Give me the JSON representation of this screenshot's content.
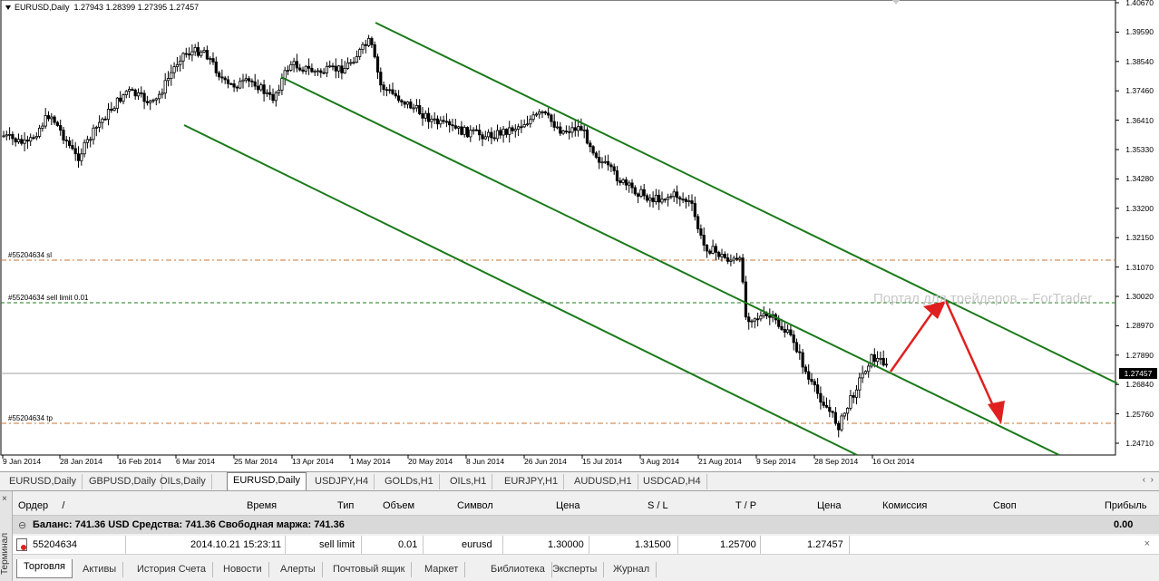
{
  "chart": {
    "title": "EURUSD,Daily",
    "ohlc": "1.27943 1.28399 1.27395 1.27457",
    "current_price": "1.27457",
    "watermark": "Портал для трейдеров – ForTrader",
    "price_labels": [
      "1.40670",
      "1.39590",
      "1.38540",
      "1.37460",
      "1.36410",
      "1.35330",
      "1.34280",
      "1.33200",
      "1.32150",
      "1.31070",
      "1.30020",
      "1.28970",
      "1.27890",
      "1.26840",
      "1.25760",
      "1.24710"
    ],
    "date_labels": [
      "9 Jan 2014",
      "28 Jan 2014",
      "16 Feb 2014",
      "6 Mar 2014",
      "25 Mar 2014",
      "13 Apr 2014",
      "1 May 2014",
      "20 May 2014",
      "8 Jun 2014",
      "26 Jun 2014",
      "15 Jul 2014",
      "3 Aug 2014",
      "21 Aug 2014",
      "9 Sep 2014",
      "28 Sep 2014",
      "16 Oct 2014"
    ],
    "levels": {
      "sl": "#55204634 sl",
      "sell_limit": "#55204634 sell limit 0.01",
      "tp": "#55204634 tp"
    }
  },
  "chart_tabs": [
    {
      "label": "EURUSD,Daily"
    },
    {
      "label": "GBPUSD,Daily"
    },
    {
      "label": "OILs,Daily"
    },
    {
      "label": "EURUSD,Daily",
      "active": true
    },
    {
      "label": "USDJPY,H4"
    },
    {
      "label": "GOLDs,H1"
    },
    {
      "label": "OILs,H1"
    },
    {
      "label": "EURJPY,H1"
    },
    {
      "label": "AUDUSD,H1"
    },
    {
      "label": "USDCAD,H4"
    }
  ],
  "terminal": {
    "side_label": "Терминал",
    "headers": {
      "order": "Ордер",
      "time": "Время",
      "type": "Тип",
      "volume": "Объем",
      "symbol": "Символ",
      "price": "Цена",
      "sl": "S / L",
      "tp": "T / P",
      "price2": "Цена",
      "commission": "Комиссия",
      "swap": "Своп",
      "profit": "Прибыль"
    },
    "balance": {
      "text": "Баланс: 741.36 USD  Средства: 741.36  Свободная маржа: 741.36",
      "profit": "0.00"
    },
    "order": {
      "id": "55204634",
      "time": "2014.10.21 15:23:11",
      "type": "sell limit",
      "volume": "0.01",
      "symbol": "eurusd",
      "price": "1.30000",
      "sl": "1.31500",
      "tp": "1.25700",
      "current": "1.27457"
    },
    "tabs": [
      {
        "label": "Торговля",
        "active": true
      },
      {
        "label": "Активы"
      },
      {
        "label": "История Счета"
      },
      {
        "label": "Новости"
      },
      {
        "label": "Алерты"
      },
      {
        "label": "Почтовый ящик"
      },
      {
        "label": "Маркет"
      },
      {
        "label": "Библиотека"
      },
      {
        "label": "Эксперты"
      },
      {
        "label": "Журнал"
      }
    ]
  },
  "colors": {
    "channel": "#1a7a1a",
    "arrow": "#e02020",
    "sl_line": "#c87533",
    "sell_line": "#1a7a1a",
    "tp_line": "#c87533",
    "candle": "#000000"
  }
}
